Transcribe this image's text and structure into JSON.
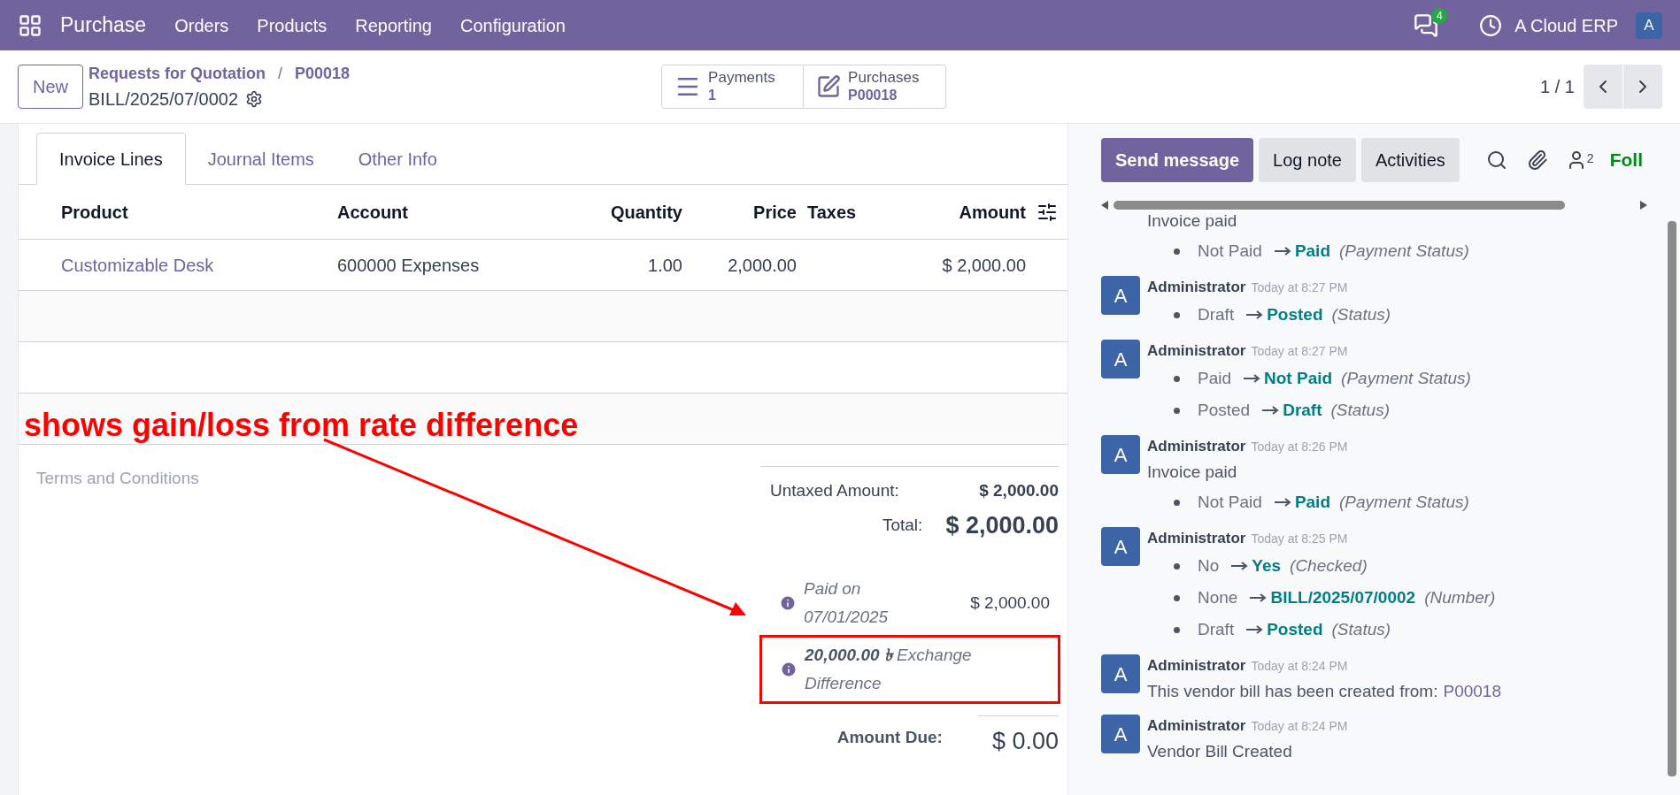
{
  "navbar": {
    "app": "Purchase",
    "menus": [
      "Orders",
      "Products",
      "Reporting",
      "Configuration"
    ],
    "message_count": "4",
    "company": "A Cloud ERP",
    "avatar": "A"
  },
  "control_panel": {
    "new_button": "New",
    "breadcrumb": "Requests for Quotation",
    "separator": "/",
    "record": "P00018",
    "title": "BILL/2025/07/0002",
    "smart_buttons": [
      {
        "kind": "list",
        "label": "Payments",
        "value": "1"
      },
      {
        "kind": "edit",
        "label": "Purchases",
        "value": "P00018"
      }
    ],
    "pager": "1 / 1"
  },
  "tabs": [
    {
      "label": "Invoice Lines",
      "selected": true
    },
    {
      "label": "Journal Items",
      "selected": false
    },
    {
      "label": "Other Info",
      "selected": false
    }
  ],
  "table": {
    "columns": [
      "Product",
      "Account",
      "Quantity",
      "Price",
      "Taxes",
      "Amount"
    ],
    "rows": [
      {
        "product": "Customizable Desk",
        "account": "600000 Expenses",
        "quantity": "1.00",
        "price": "2,000.00",
        "amount": "$ 2,000.00"
      }
    ]
  },
  "annotation": {
    "text": "shows gain/loss from rate difference"
  },
  "terms": {
    "placeholder": "Terms and Conditions"
  },
  "totals": {
    "untaxed_label": "Untaxed Amount:",
    "untaxed": "$ 2,000.00",
    "total_label": "Total:",
    "total": "$ 2,000.00",
    "payments": [
      {
        "label": "Paid on 07/01/2025",
        "amount": "$ 2,000.00",
        "highlighted": false
      },
      {
        "label": "Exchange Difference",
        "amount_prefix": "20,000.00 ৳",
        "highlighted": true
      }
    ],
    "due_label": "Amount Due:",
    "due": "$ 0.00"
  },
  "chatter": {
    "buttons": [
      {
        "label": "Send message",
        "selected": true
      },
      {
        "label": "Log note",
        "selected": false
      },
      {
        "label": "Activities",
        "selected": false
      }
    ],
    "followers_count": "2",
    "follow": "Foll",
    "messages": [
      {
        "kind": "continued",
        "body": "Invoice paid",
        "changes": [
          {
            "old": "Not Paid",
            "new": "Paid",
            "field": "(Payment Status)"
          }
        ]
      },
      {
        "kind": "full",
        "avatar": "A",
        "author": "Administrator",
        "time": "Today at 8:27 PM",
        "changes": [
          {
            "old": "Draft",
            "new": "Posted",
            "field": "(Status)"
          }
        ]
      },
      {
        "kind": "full",
        "avatar": "A",
        "author": "Administrator",
        "time": "Today at 8:27 PM",
        "changes": [
          {
            "old": "Paid",
            "new": "Not Paid",
            "field": "(Payment Status)"
          },
          {
            "old": "Posted",
            "new": "Draft",
            "field": "(Status)"
          }
        ]
      },
      {
        "kind": "full",
        "avatar": "A",
        "author": "Administrator",
        "time": "Today at 8:26 PM",
        "body": "Invoice paid",
        "changes": [
          {
            "old": "Not Paid",
            "new": "Paid",
            "field": "(Payment Status)"
          }
        ]
      },
      {
        "kind": "full",
        "avatar": "A",
        "author": "Administrator",
        "time": "Today at 8:25 PM",
        "changes": [
          {
            "old": "No",
            "new": "Yes",
            "field": "(Checked)"
          },
          {
            "old": "None",
            "new": "BILL/2025/07/0002",
            "field": "(Number)"
          },
          {
            "old": "Draft",
            "new": "Posted",
            "field": "(Status)"
          }
        ]
      },
      {
        "kind": "full",
        "avatar": "A",
        "author": "Administrator",
        "time": "Today at 8:24 PM",
        "body": "This vendor bill has been created from:",
        "link": "P00018"
      },
      {
        "kind": "full",
        "avatar": "A",
        "author": "Administrator",
        "time": "Today at 8:24 PM",
        "body": "Vendor Bill Created"
      }
    ]
  }
}
